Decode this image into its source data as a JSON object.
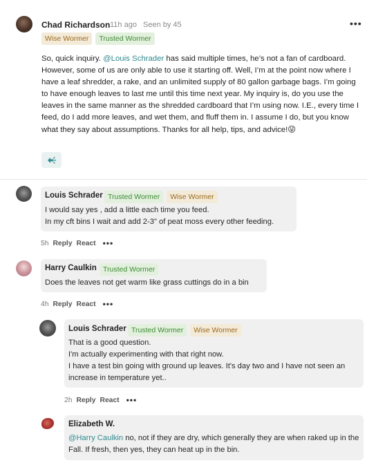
{
  "post": {
    "author": "Chad Richardson",
    "time": "11h ago",
    "seen": "Seen by 45",
    "more": "•••",
    "badges": [
      "Wise Wormer",
      "Trusted Wormer"
    ],
    "body_before": "So, quick inquiry. ",
    "mention": "@Louis Schrader",
    "body_after": " has said multiple times, he’s not a fan of cardboard. However, some of us are only able to use it starting off. Well, I’m at the point now where I have a leaf shredder, a rake, and an unlimited supply of 80 gallon garbage bags. I’m going to have enough leaves to last me until this time next year. My inquiry is, do you use the leaves in the same manner as the shredded cardboard that I’m using now. I.E., every time I feed, do I add more leaves, and wet them, and fluff them in. I assume I do, but you know what they say about assumptions. Thanks for all help, tips, and advice!",
    "emoji": "😜"
  },
  "comments": [
    {
      "author": "Louis Schrader",
      "badges": [
        "Trusted Wormer",
        "Wise Wormer"
      ],
      "lines": [
        "I would say yes , add a little each time you feed.",
        "In my cft bins I wait and add 2-3\" of peat moss every other feeding."
      ],
      "time": "5h",
      "reply": "Reply",
      "react": "React",
      "more": "•••"
    },
    {
      "author": "Harry Caulkin",
      "badges": [
        "Trusted Wormer"
      ],
      "lines": [
        "Does the leaves not get warm like grass cuttings do in a bin"
      ],
      "time": "4h",
      "reply": "Reply",
      "react": "React",
      "more": "•••"
    },
    {
      "author": "Louis Schrader",
      "badges": [
        "Trusted Wormer",
        "Wise Wormer"
      ],
      "lines": [
        "That is a good question.",
        "I'm actually experimenting with that right now.",
        "I have a test bin going with ground up leaves. It's day two and I have not seen an increase in temperature yet.."
      ],
      "time": "2h",
      "reply": "Reply",
      "react": "React",
      "more": "•••"
    },
    {
      "author": "Elizabeth W.",
      "mention": "@Harry Caulkin",
      "text_after": " no, not if they are dry, which generally they are when raked up in the Fall. If fresh, then yes, they can heat up in the bin."
    }
  ],
  "colors": {
    "mention": "#2f8a8f",
    "badge_wise_bg": "#f3ead8",
    "badge_wise_text": "#9a6b1f",
    "badge_trusted_bg": "#e3f0de",
    "badge_trusted_text": "#3d8a33",
    "bubble_bg": "#f0f0f0"
  },
  "icons": {
    "reaction": "add-reaction-icon",
    "more": "more-options-icon"
  }
}
